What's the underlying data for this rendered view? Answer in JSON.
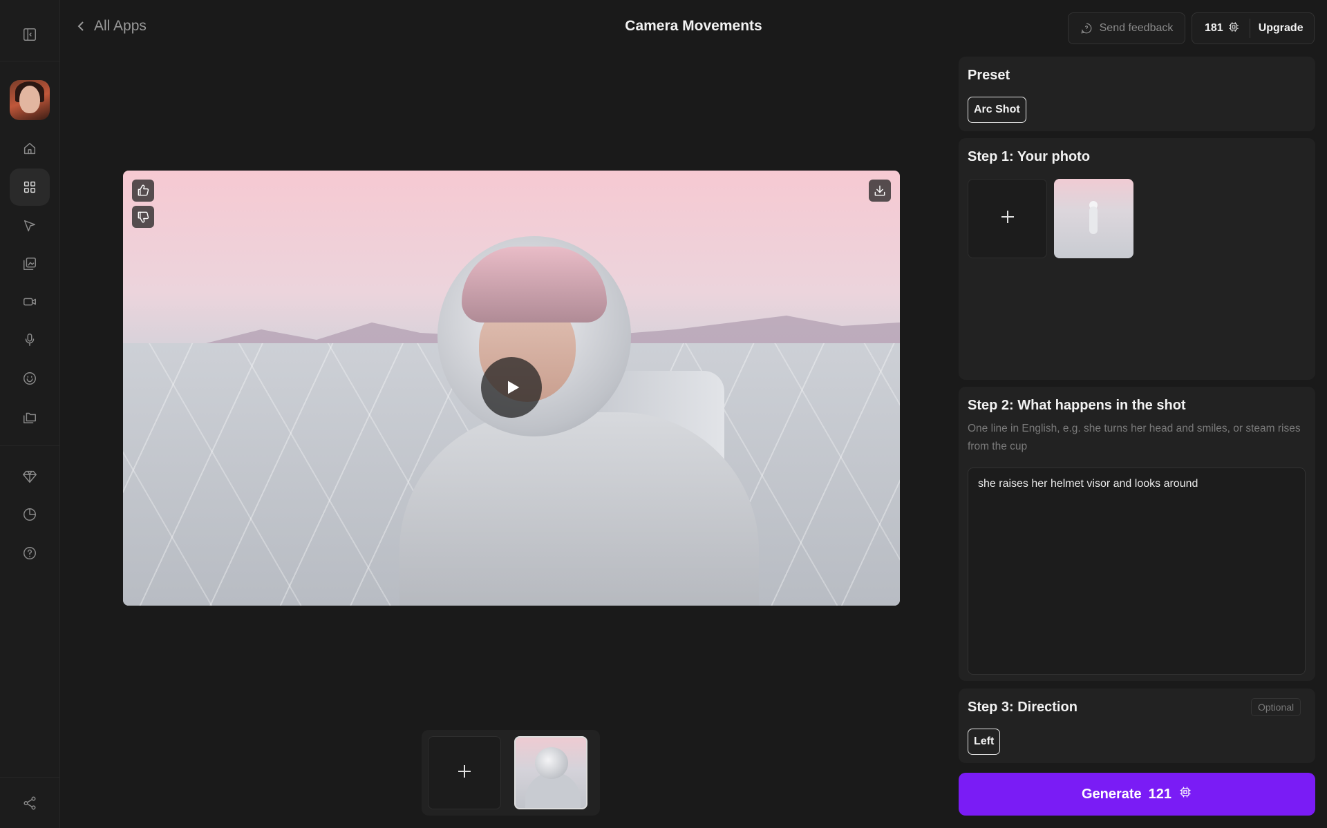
{
  "header": {
    "back_label": "All Apps",
    "title": "Camera Movements",
    "feedback_label": "Send feedback",
    "credits": "181",
    "upgrade_label": "Upgrade"
  },
  "sidebar": {
    "icons": [
      "panel-toggle-icon",
      "avatar",
      "home-icon",
      "apps-grid-icon",
      "cursor-icon",
      "image-edit-icon",
      "video-icon",
      "microphone-icon",
      "smiley-icon",
      "folder-icon",
      "diamond-icon",
      "pie-chart-icon",
      "help-icon",
      "share-icon"
    ],
    "active": "apps-grid-icon"
  },
  "preset": {
    "title": "Preset",
    "selected": "Arc Shot"
  },
  "step1": {
    "title": "Step 1: Your photo"
  },
  "step2": {
    "title": "Step 2: What happens in the shot",
    "hint": "One line in English, e.g. she turns her head and smiles, or steam rises from the cup",
    "prompt": "she raises her helmet visor and looks around"
  },
  "step3": {
    "title": "Step 3: Direction",
    "optional_label": "Optional",
    "selected": "Left"
  },
  "generate": {
    "label": "Generate",
    "cost": "121"
  },
  "colors": {
    "accent": "#7a1cf5",
    "background": "#1a1a1a",
    "card": "#222222"
  }
}
